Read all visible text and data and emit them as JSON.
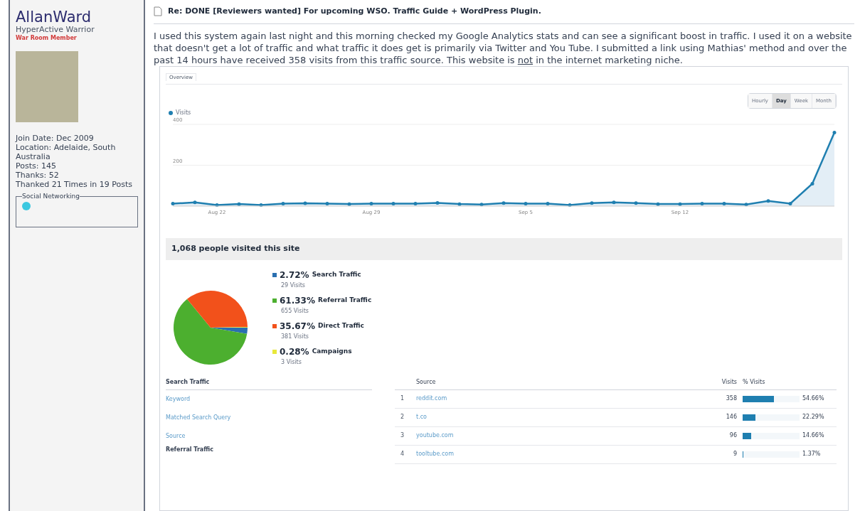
{
  "user": {
    "name": "AllanWard",
    "rank": "HyperActive Warrior",
    "group": "War Room Member",
    "details": [
      "Join Date: Dec 2009",
      "Location: Adelaide, South Australia",
      "Posts: 145",
      "Thanks: 52",
      "Thanked 21 Times in 19 Posts"
    ],
    "social_title": "Social Networking"
  },
  "post": {
    "title": "Re: DONE [Reviewers wanted] For upcoming WSO. Traffic Guide + WordPress Plugin.",
    "body": [
      {
        "text": "I used this system again last night and this morning checked my Google Analytics stats and can see a significant boost in traffic. I used it on a website that doesn't get a lot of traffic and what traffic it does get is primarily via Twitter and You Tube. I submitted a link using Mathias' method and over the past 14 hours have received 358 visits from this traffic source. This website is ",
        "underline": false
      },
      {
        "text": "not",
        "underline": true
      },
      {
        "text": " in the internet marketing niche.",
        "underline": false
      }
    ]
  },
  "analytics": {
    "tab": "Overview",
    "periods": [
      {
        "label": "Hourly",
        "selected": false
      },
      {
        "label": "Day",
        "selected": true
      },
      {
        "label": "Week",
        "selected": false
      },
      {
        "label": "Month",
        "selected": false
      }
    ],
    "visits_chart": {
      "chart_data": {
        "type": "area",
        "categories": [
          null,
          null,
          "Aug 22",
          null,
          null,
          null,
          null,
          null,
          null,
          "Aug 29",
          null,
          null,
          null,
          null,
          null,
          null,
          "Sep 5",
          null,
          null,
          null,
          null,
          null,
          null,
          "Sep 12",
          null,
          null,
          null,
          null,
          null,
          null,
          null
        ],
        "series": [
          {
            "name": "Visits",
            "color": "#1f7fb0",
            "values": [
              12,
              18,
              5,
              10,
              5,
              12,
              14,
              12,
              10,
              12,
              12,
              12,
              16,
              10,
              8,
              15,
              12,
              12,
              5,
              15,
              18,
              15,
              10,
              10,
              12,
              12,
              8,
              25,
              12,
              110,
              360
            ]
          }
        ],
        "ylim": [
          0,
          400
        ],
        "yticks": [
          200,
          400
        ]
      }
    },
    "summary": "1,068 people visited this site",
    "traffic_chart": {
      "chart_data": {
        "type": "pie",
        "categories": [
          "Search Traffic",
          "Referral Traffic",
          "Direct Traffic",
          "Campaigns"
        ],
        "series": [
          {
            "values": [
              2.72,
              61.33,
              35.67,
              0.28
            ]
          }
        ],
        "colors": [
          "#2a6fb0",
          "#4caf2f",
          "#f2511b",
          "#e8e83a"
        ]
      }
    },
    "legend": [
      {
        "percent": "2.72%",
        "visits": "29 Visits",
        "color": "#2a6fb0"
      },
      {
        "percent": "61.33%",
        "visits": "655 Visits",
        "color": "#4caf2f"
      },
      {
        "percent": "35.67%",
        "visits": "381 Visits",
        "color": "#f2511b"
      },
      {
        "percent": "0.28%",
        "visits": "3 Visits",
        "color": "#e8e83a"
      }
    ],
    "search_traffic": {
      "title": "Search Traffic",
      "links": [
        "Keyword",
        "Matched Search Query",
        "Source"
      ],
      "next_title": "Referral Traffic"
    },
    "sources": {
      "columns": [
        "Source",
        "Visits",
        "% Visits"
      ],
      "rows": [
        {
          "rank": "1",
          "source": "reddit.com",
          "visits": "358",
          "percent": "54.66%",
          "level": 0.5466
        },
        {
          "rank": "2",
          "source": "t.co",
          "visits": "146",
          "percent": "22.29%",
          "level": 0.2229
        },
        {
          "rank": "3",
          "source": "youtube.com",
          "visits": "96",
          "percent": "14.66%",
          "level": 0.1466
        },
        {
          "rank": "4",
          "source": "tooltube.com",
          "visits": "9",
          "percent": "1.37%",
          "level": 0.0137
        }
      ]
    }
  }
}
